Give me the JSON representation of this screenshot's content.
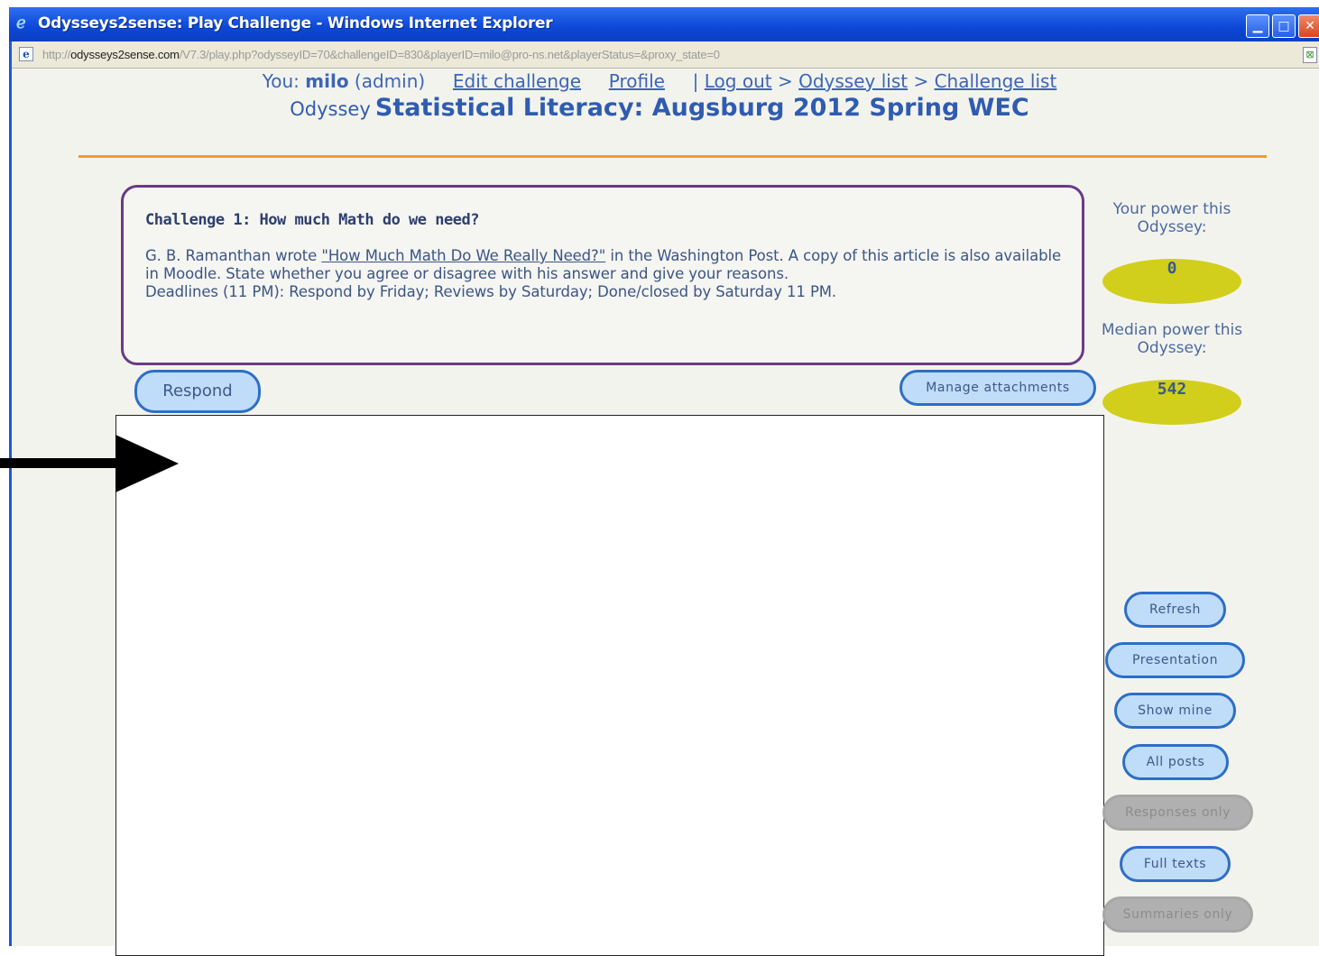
{
  "window": {
    "title": "Odysseys2sense: Play Challenge - Windows Internet Explorer",
    "minimize": "▁",
    "maximize": "□",
    "close": "✕"
  },
  "address": {
    "prefix": "http://",
    "domain": "odysseys2sense.com",
    "path": "/V7.3/play.php?odysseyID=70&challengeID=830&playerID=milo@pro-ns.net&playerStatus=&proxy_state=0"
  },
  "nav": {
    "you_label": "You:",
    "user": "milo",
    "role": "(admin)",
    "edit_challenge": "Edit challenge",
    "profile": "Profile",
    "pipe": "|",
    "logout": "Log out",
    "sep1": ">",
    "odyssey_list": "Odyssey list",
    "sep2": ">",
    "challenge_list": "Challenge list"
  },
  "header": {
    "prefix": "Odyssey",
    "title": "Statistical Literacy: Augsburg 2012 Spring WEC"
  },
  "challenge": {
    "heading": "Challenge 1: How much Math do we need?",
    "text_before_link": "G. B. Ramanthan wrote ",
    "link": "\"How Much Math Do We Really Need?\"",
    "text_after_link": " in the Washington Post. A copy of this article is also available in Moodle.  State whether you agree or disagree with his answer and give your reasons.",
    "deadlines": "Deadlines (11 PM): Respond by Friday; Reviews by Saturday; Done/closed by Saturday 11 PM."
  },
  "buttons": {
    "respond": "Respond",
    "manage_attachments": "Manage attachments",
    "refresh": "Refresh",
    "presentation": "Presentation",
    "show_mine": "Show mine",
    "all_posts": "All posts",
    "responses_only": "Responses only",
    "full_texts": "Full texts",
    "summaries_only": "Summaries only"
  },
  "power": {
    "your_label": "Your power this Odyssey:",
    "your_value": "0",
    "median_label": "Median power this Odyssey:",
    "median_value": "542"
  },
  "colors": {
    "titlebar": "#0c47d6",
    "accent_rule": "#f59a22",
    "challenge_border": "#6a3a86",
    "pill_fill": "#bfdcf8",
    "pill_border": "#2d6ec8",
    "oval": "#d1cf1c"
  }
}
